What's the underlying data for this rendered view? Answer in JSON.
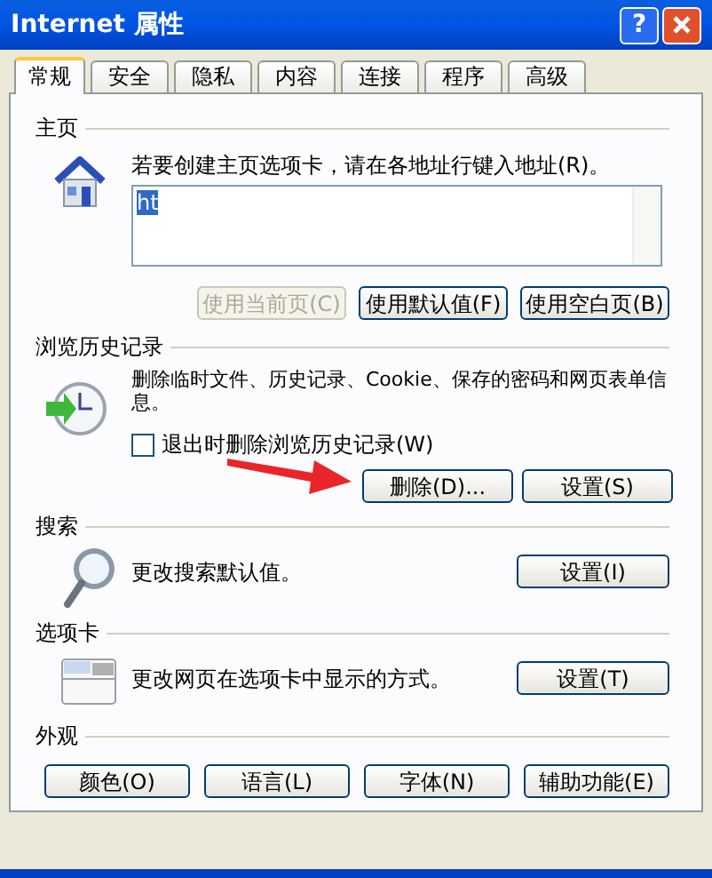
{
  "window": {
    "title": "Internet 属性",
    "help_label": "?"
  },
  "tabs": [
    {
      "label": "常规",
      "selected": true
    },
    {
      "label": "安全",
      "selected": false
    },
    {
      "label": "隐私",
      "selected": false
    },
    {
      "label": "内容",
      "selected": false
    },
    {
      "label": "连接",
      "selected": false
    },
    {
      "label": "程序",
      "selected": false
    },
    {
      "label": "高级",
      "selected": false
    }
  ],
  "sections": [
    {
      "kind": "home",
      "title": "主页",
      "description": "若要创建主页选项卡，请在各地址行键入地址(R)。",
      "address": "ht",
      "buttons": [
        {
          "label": "使用当前页(C)",
          "disabled": true
        },
        {
          "label": "使用默认值(F)",
          "disabled": false
        },
        {
          "label": "使用空白页(B)",
          "disabled": false
        }
      ]
    },
    {
      "kind": "history",
      "title": "浏览历史记录",
      "description": "删除临时文件、历史记录、Cookie、保存的密码和网页表单信息。",
      "checkbox": {
        "label": "退出时删除浏览历史记录(W)",
        "checked": false
      },
      "buttons": [
        {
          "label": "删除(D)...",
          "disabled": false
        },
        {
          "label": "设置(S)",
          "disabled": false
        }
      ]
    },
    {
      "kind": "search",
      "title": "搜索",
      "description": "更改搜索默认值。",
      "buttons": [
        {
          "label": "设置(I)",
          "disabled": false
        }
      ]
    },
    {
      "kind": "tabs",
      "title": "选项卡",
      "description": "更改网页在选项卡中显示的方式。",
      "buttons": [
        {
          "label": "设置(T)",
          "disabled": false
        }
      ]
    },
    {
      "kind": "appearance",
      "title": "外观",
      "buttons": [
        {
          "label": "颜色(O)",
          "disabled": false
        },
        {
          "label": "语言(L)",
          "disabled": false
        },
        {
          "label": "字体(N)",
          "disabled": false
        },
        {
          "label": "辅助功能(E)",
          "disabled": false
        }
      ]
    }
  ],
  "annotations": [
    {
      "kind": "arrow"
    }
  ]
}
